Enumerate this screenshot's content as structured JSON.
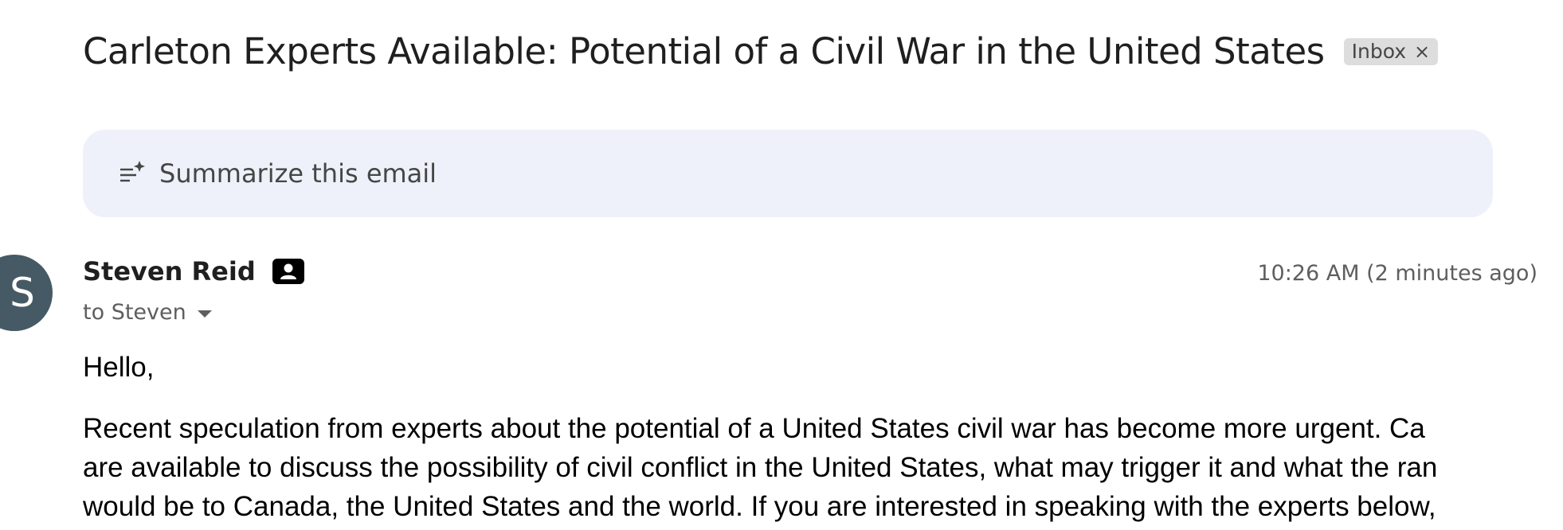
{
  "email": {
    "subject": "Carleton Experts Available: Potential of a Civil War in the United States",
    "label": "Inbox",
    "label_close": "×",
    "summarize_label": "Summarize this email",
    "sender": {
      "initial": "S",
      "name": "Steven Reid",
      "avatar_color": "#455a64"
    },
    "timestamp": "10:26 AM (2 minutes ago)",
    "recipient": "to Steven",
    "body": {
      "greeting": "Hello,",
      "paragraph_lines": [
        "Recent speculation from experts about the potential of a United States civil war has become more urgent.  Ca",
        "are available to discuss the possibility of civil conflict in the United States, what may trigger it and what the ran",
        "would be to Canada, the United States and the world. If you are interested in speaking with the experts below,"
      ]
    }
  },
  "icons": {
    "summarize": "summarize-sparkle-icon",
    "contact": "contact-card-icon",
    "recipient_details": "chevron-down-icon",
    "remove_label": "close-icon"
  }
}
